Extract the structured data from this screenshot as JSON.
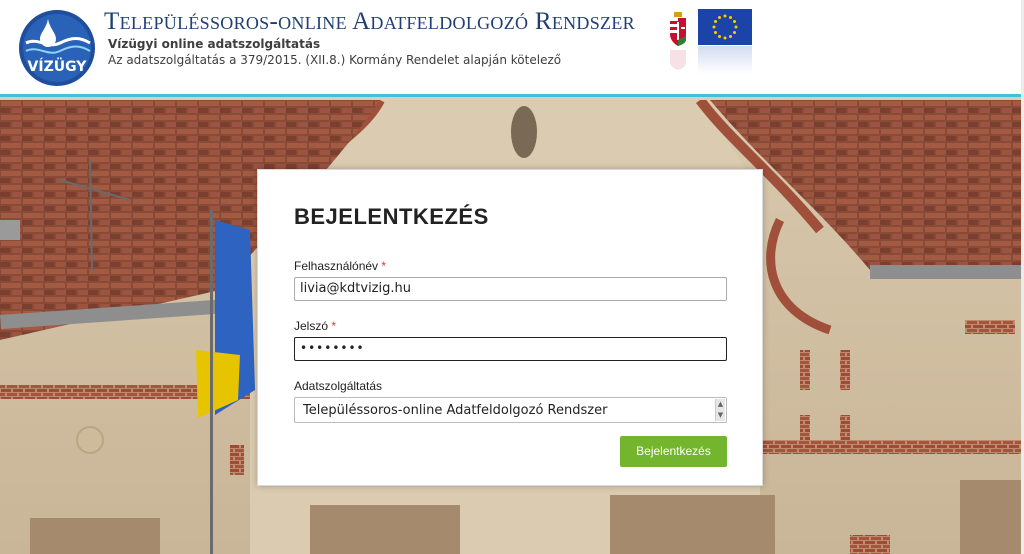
{
  "header": {
    "title": "Településsoros-online Adatfeldolgozó Rendszer",
    "subtitle": "Vízügyi online adatszolgáltatás",
    "subline": "Az adatszolgáltatás a 379/2015. (XII.8.) Kormány Rendelet alapján kötelező",
    "logo_text": "VÍZÜGY"
  },
  "login": {
    "heading": "BEJELENTKEZÉS",
    "username_label": "Felhasználónév",
    "username_value": "livia@kdtvizig.hu",
    "password_label": "Jelszó",
    "password_value": "••••••••",
    "required_mark": "*",
    "service_label": "Adatszolgáltatás",
    "service_selected": "Településsoros-online Adatfeldolgozó Rendszer",
    "submit_label": "Bejelentkezés"
  },
  "colors": {
    "accent": "#3cc3d8",
    "title": "#1f3f72",
    "button": "#73b62e",
    "eu_blue": "#1c44a8",
    "eu_star": "#ffcc00"
  }
}
